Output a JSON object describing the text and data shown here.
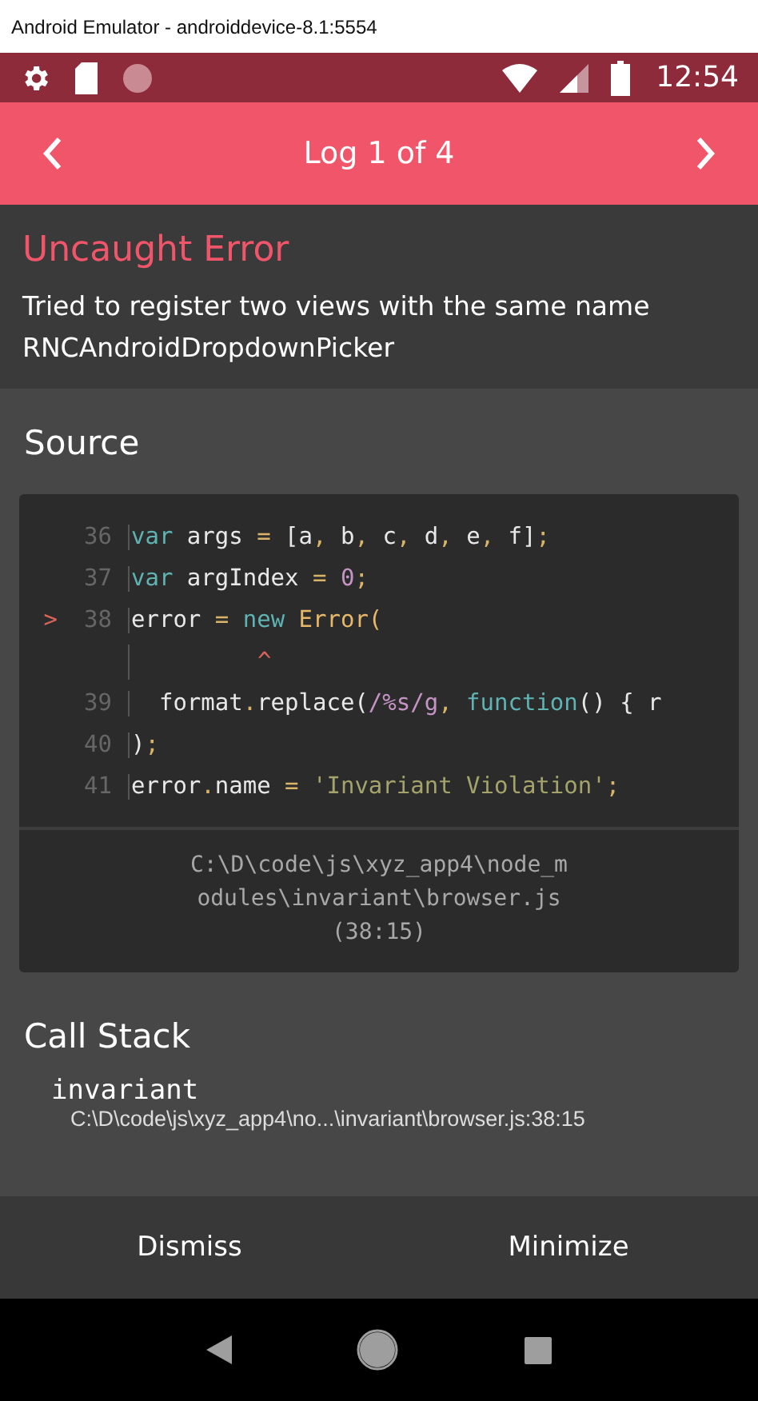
{
  "window": {
    "title": "Android Emulator - androiddevice-8.1:5554"
  },
  "status_bar": {
    "time": "12:54"
  },
  "header": {
    "title": "Log 1 of 4"
  },
  "error": {
    "title": "Uncaught Error",
    "message": "Tried to register two views with the same name RNCAndroidDropdownPicker"
  },
  "source": {
    "title": "Source",
    "lines": [
      {
        "kind": "code",
        "number": "36",
        "tokens": [
          {
            "kind": "kw",
            "s": "var"
          },
          {
            "kind": "id",
            "s": " args "
          },
          {
            "kind": "op",
            "s": "="
          },
          {
            "kind": "id",
            "s": " [a"
          },
          {
            "kind": "op",
            "s": ","
          },
          {
            "kind": "id",
            "s": " b"
          },
          {
            "kind": "op",
            "s": ","
          },
          {
            "kind": "id",
            "s": " c"
          },
          {
            "kind": "op",
            "s": ","
          },
          {
            "kind": "id",
            "s": " d"
          },
          {
            "kind": "op",
            "s": ","
          },
          {
            "kind": "id",
            "s": " e"
          },
          {
            "kind": "op",
            "s": ","
          },
          {
            "kind": "id",
            "s": " f]"
          },
          {
            "kind": "op",
            "s": ";"
          }
        ]
      },
      {
        "kind": "code",
        "number": "37",
        "tokens": [
          {
            "kind": "kw",
            "s": "var"
          },
          {
            "kind": "id",
            "s": " argIndex "
          },
          {
            "kind": "op",
            "s": "="
          },
          {
            "kind": "num",
            "s": " 0"
          },
          {
            "kind": "op",
            "s": ";"
          }
        ]
      },
      {
        "kind": "code",
        "number": "38",
        "marker": ">",
        "tokens": [
          {
            "kind": "id",
            "s": "error "
          },
          {
            "kind": "op",
            "s": "="
          },
          {
            "kind": "kw",
            "s": " new"
          },
          {
            "kind": "cls",
            "s": " Error("
          }
        ]
      },
      {
        "kind": "caret",
        "text": "^"
      },
      {
        "kind": "code",
        "number": "39",
        "tokens": [
          {
            "kind": "id",
            "s": "  format"
          },
          {
            "kind": "op",
            "s": "."
          },
          {
            "kind": "id",
            "s": "replace("
          },
          {
            "kind": "num",
            "s": "/%s/g"
          },
          {
            "kind": "op",
            "s": ","
          },
          {
            "kind": "kw",
            "s": " function"
          },
          {
            "kind": "id",
            "s": "() { r"
          }
        ]
      },
      {
        "kind": "code",
        "number": "40",
        "tokens": [
          {
            "kind": "id",
            "s": ")"
          },
          {
            "kind": "op",
            "s": ";"
          }
        ]
      },
      {
        "kind": "code",
        "number": "41",
        "tokens": [
          {
            "kind": "id",
            "s": "error"
          },
          {
            "kind": "op",
            "s": "."
          },
          {
            "kind": "id",
            "s": "name "
          },
          {
            "kind": "op",
            "s": "="
          },
          {
            "kind": "str",
            "s": " 'Invariant Violation'"
          },
          {
            "kind": "op",
            "s": ";"
          }
        ]
      }
    ],
    "file": "C:\\D\\code\\js\\xyz_app4\\node_modules\\invariant\\browser.js",
    "position": "(38:15)"
  },
  "call_stack": {
    "title": "Call Stack",
    "frames": [
      {
        "name": "invariant",
        "location": "C:\\D\\code\\js\\xyz_app4\\no...\\invariant\\browser.js:38:15"
      }
    ]
  },
  "buttons": [
    "Dismiss",
    "Minimize"
  ]
}
